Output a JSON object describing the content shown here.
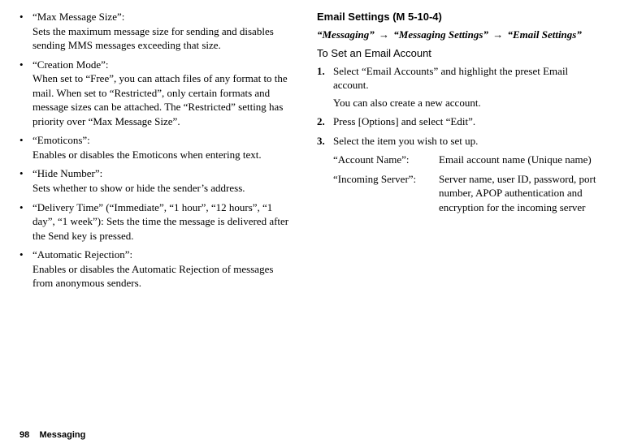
{
  "left": {
    "items": [
      {
        "title": "“Max Message Size”:",
        "desc": "Sets the maximum message size for sending and disables sending MMS messages exceeding that size."
      },
      {
        "title": "“Creation Mode”:",
        "desc": "When set to “Free”, you can attach files of any format to the mail. When set to “Restricted”, only certain formats and message sizes can be attached. The “Restricted” setting has priority over “Max Message Size”."
      },
      {
        "title": "“Emoticons”:",
        "desc": "Enables or disables the Emoticons when entering text."
      },
      {
        "title": "“Hide Number”:",
        "desc": "Sets whether to show or hide the sender’s address."
      },
      {
        "title": "",
        "desc": "“Delivery Time” (“Immediate”, “1 hour”, “12 hours”, “1 day”, “1 week”): Sets the time the message is delivered after the Send key is pressed."
      },
      {
        "title": "“Automatic Rejection”:",
        "desc": "Enables or disables the Automatic Rejection of messages from anonymous senders."
      }
    ]
  },
  "right": {
    "heading_prefix": "Email Settings",
    "heading_suffix": " (M 5-10-4)",
    "breadcrumb": {
      "part1": "“Messaging”",
      "part2": "“Messaging Settings”",
      "part3": "“Email Settings”"
    },
    "subhead": "To Set an Email Account",
    "steps": [
      {
        "num": "1.",
        "text": "Select “Email Accounts” and highlight the preset Email account.",
        "sub": "You can also create a new account."
      },
      {
        "num": "2.",
        "text": "Press [Options] and select “Edit”."
      },
      {
        "num": "3.",
        "text": "Select the item you wish to set up."
      }
    ],
    "defs": [
      {
        "term": "“Account Name”:",
        "def": "Email account name (Unique name)"
      },
      {
        "term": "“Incoming Server”:",
        "def": "Server name, user ID, password, port number, APOP authentication and encryption for the incoming server"
      }
    ]
  },
  "footer": {
    "page": "98",
    "section": "Messaging"
  },
  "glyphs": {
    "bullet": "•",
    "arrow": "→"
  }
}
